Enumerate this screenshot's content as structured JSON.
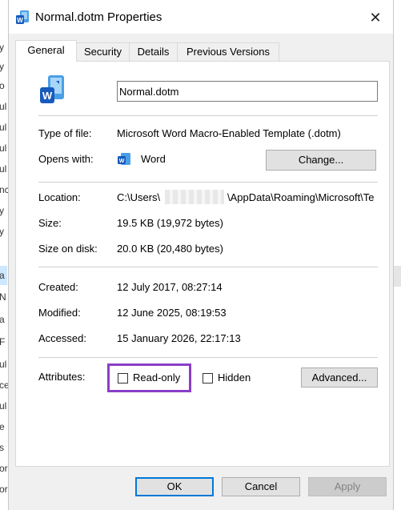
{
  "window": {
    "title": "Normal.dotm Properties",
    "close_glyph": "✕"
  },
  "tabs": [
    {
      "label": "General",
      "active": true
    },
    {
      "label": "Security",
      "active": false
    },
    {
      "label": "Details",
      "active": false
    },
    {
      "label": "Previous Versions",
      "active": false
    }
  ],
  "file": {
    "name": "Normal.dotm",
    "icon": "word-template-icon"
  },
  "rows": {
    "type_label": "Type of file:",
    "type_value": "Microsoft Word Macro-Enabled Template (.dotm)",
    "opens_label": "Opens with:",
    "opens_value": "Word",
    "change_button": "Change...",
    "location_label": "Location:",
    "location_prefix": "C:\\Users\\",
    "location_suffix": "\\AppData\\Roaming\\Microsoft\\Te",
    "size_label": "Size:",
    "size_value": "19.5 KB (19,972 bytes)",
    "size_disk_label": "Size on disk:",
    "size_disk_value": "20.0 KB (20,480 bytes)",
    "created_label": "Created:",
    "created_value": "12 July 2017, 08:27:14",
    "modified_label": "Modified:",
    "modified_value": "12 June 2025, 08:19:53",
    "accessed_label": "Accessed:",
    "accessed_value": "15 January 2026, 22:17:13"
  },
  "attributes": {
    "label": "Attributes:",
    "readonly_label": "Read-only",
    "readonly_checked": false,
    "hidden_label": "Hidden",
    "hidden_checked": false,
    "advanced_button": "Advanced...",
    "highlight_color": "#8b3ec9"
  },
  "footer": {
    "ok": "OK",
    "cancel": "Cancel",
    "apply": "Apply"
  },
  "background_fragments": [
    "y",
    "y",
    "o",
    "ul",
    "ul",
    "ul",
    "ul",
    "nc",
    "y",
    "y",
    "a",
    "N",
    "a",
    "F",
    "ul",
    "ce",
    "ul",
    "e",
    "s",
    "or",
    "or",
    "or"
  ],
  "colors": {
    "accent": "#0078d7",
    "word_blue": "#185abd"
  }
}
